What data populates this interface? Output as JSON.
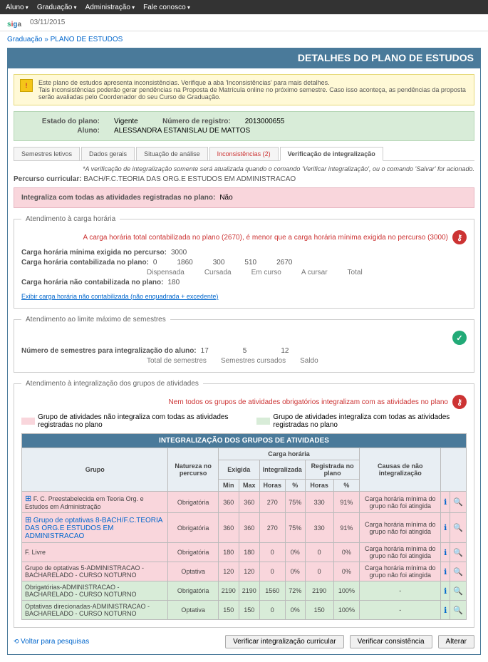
{
  "topbar": {
    "items": [
      "Aluno",
      "Graduação",
      "Administração",
      "Fale conosco"
    ]
  },
  "date": "03/11/2015",
  "logo": {
    "s": "s",
    "i": "i",
    "g": "g",
    "a": "a"
  },
  "bread": {
    "a": "Graduação",
    "b": "PLANO DE ESTUDOS"
  },
  "header": "DETALHES DO PLANO DE ESTUDOS",
  "warn": {
    "l1": "Este plano de estudos apresenta inconsistências. Verifique a aba 'Inconsistências' para mais detalhes.",
    "l2": "Tais inconsistências poderão gerar pendências na Proposta de Matrícula online no próximo semestre. Caso isso aconteça, as pendências da proposta serão avaliadas pelo Coordenador do seu Curso de Graduação."
  },
  "info": {
    "estado_l": "Estado do plano:",
    "estado_v": "Vigente",
    "num_l": "Número de registro:",
    "num_v": "2013000655",
    "aluno_l": "Aluno:",
    "aluno_v": "ALESSANDRA ESTANISLAU DE MATTOS"
  },
  "tabs": [
    "Semestres letivos",
    "Dados gerais",
    "Situação de análise",
    "Inconsistências (2)",
    "Verificação de integralização"
  ],
  "note": "*A verificação de integralização somente será atualizada quando o comando 'Verificar integralização', ou o comando 'Salvar' for acionado.",
  "percurso": {
    "l": "Percurso curricular:",
    "v": "BACH/F.C.TEORIA DAS ORG.E ESTUDOS EM ADMINISTRACAO"
  },
  "integra": {
    "l": "Integraliza com todas as atividades registradas no plano:",
    "v": "Não"
  },
  "fs1": {
    "legend": "Atendimento à carga horária",
    "err": "A carga horária total contabilizada no plano (2670), é menor que a carga horária mínima exigida no percurso (3000)",
    "r1l": "Carga horária mínima exigida no percurso:",
    "r1v": "3000",
    "r2l": "Carga horária contabilizada no plano:",
    "r2v": "0",
    "r2h": [
      "Dispensada",
      "Cursada",
      "Em curso",
      "A cursar",
      "Total"
    ],
    "r2vals": [
      "0",
      "1860",
      "300",
      "510",
      "2670"
    ],
    "r3l": "Carga horária não contabilizada no plano:",
    "r3v": "180",
    "link": "Exibir carga horária não contabilizada (não enquadrada + excedente)"
  },
  "fs2": {
    "legend": "Atendimento ao limite máximo de semestres",
    "l": "Número de semestres para integralização do aluno:",
    "h": [
      "Total de semestres",
      "Semestres cursados",
      "Saldo"
    ],
    "v": [
      "17",
      "5",
      "12"
    ]
  },
  "fs3": {
    "legend": "Atendimento à integralização dos grupos de atividades",
    "err": "Nem todos os grupos de atividades obrigatórios integralizam com as atividades no plano",
    "leg1": "Grupo de atividades não integraliza com todas as atividades registradas no plano",
    "leg2": "Grupo de atividades integraliza com todas as atividades registradas no plano",
    "tabletitle": "INTEGRALIZAÇÃO DOS GRUPOS DE ATIVIDADES",
    "cols": {
      "grupo": "Grupo",
      "nat": "Natureza no percurso",
      "ch": "Carga horária",
      "exi": "Exigida",
      "int": "Integralizada",
      "reg": "Registrada no plano",
      "min": "Min",
      "max": "Max",
      "h": "Horas",
      "p": "%",
      "causa": "Causas de não integralização"
    },
    "rows": [
      {
        "c": "rpink",
        "g": "F. C. Preestabelecida em Teoria Org. e Estudos em Administração",
        "n": "Obrigatória",
        "min": "360",
        "max": "360",
        "ih": "270",
        "ip": "75%",
        "rh": "330",
        "rp": "91%",
        "causa": "Carga horária mínima do grupo não foi atingida",
        "exp": true
      },
      {
        "c": "rpink",
        "g": "Grupo de optativas 8-BACH/F.C.TEORIA DAS ORG.E ESTUDOS EM ADMINISTRACAO",
        "n": "Obrigatória",
        "min": "360",
        "max": "360",
        "ih": "270",
        "ip": "75%",
        "rh": "330",
        "rp": "91%",
        "causa": "Carga horária mínima do grupo não foi atingida",
        "exp": true,
        "link": true
      },
      {
        "c": "rpink",
        "g": "F. Livre",
        "n": "Obrigatória",
        "min": "180",
        "max": "180",
        "ih": "0",
        "ip": "0%",
        "rh": "0",
        "rp": "0%",
        "causa": "Carga horária mínima do grupo não foi atingida",
        "exp": false
      },
      {
        "c": "rpink",
        "g": "Grupo de optativas 5-ADMINISTRACAO - BACHARELADO - CURSO NOTURNO",
        "n": "Optativa",
        "min": "120",
        "max": "120",
        "ih": "0",
        "ip": "0%",
        "rh": "0",
        "rp": "0%",
        "causa": "Carga horária mínima do grupo não foi atingida",
        "exp": false
      },
      {
        "c": "rgreen",
        "g": "Obrigatórias-ADMINISTRACAO - BACHARELADO - CURSO NOTURNO",
        "n": "Obrigatória",
        "min": "2190",
        "max": "2190",
        "ih": "1560",
        "ip": "72%",
        "rh": "2190",
        "rp": "100%",
        "causa": "-",
        "exp": false
      },
      {
        "c": "rgreen",
        "g": "Optativas direcionadas-ADMINISTRACAO - BACHARELADO - CURSO NOTURNO",
        "n": "Optativa",
        "min": "150",
        "max": "150",
        "ih": "0",
        "ip": "0%",
        "rh": "150",
        "rp": "100%",
        "causa": "-",
        "exp": false
      }
    ]
  },
  "btns": {
    "back": "Voltar para pesquisas",
    "b1": "Verificar integralização curricular",
    "b2": "Verificar consistência",
    "b3": "Alterar"
  }
}
